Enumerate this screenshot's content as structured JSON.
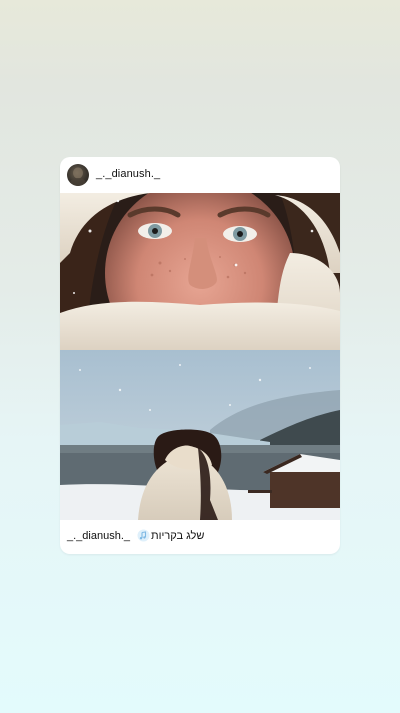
{
  "post": {
    "username": "_._dianush._",
    "caption_user": "_._dianush._",
    "music_icon": "music-note-icon",
    "song_title": "שלג בקריות"
  },
  "colors": {
    "background_top": "#e7e9da",
    "background_bottom": "#e3fbfc",
    "card": "#ffffff",
    "text": "#111111",
    "music_icon": "#7fb9e4"
  }
}
